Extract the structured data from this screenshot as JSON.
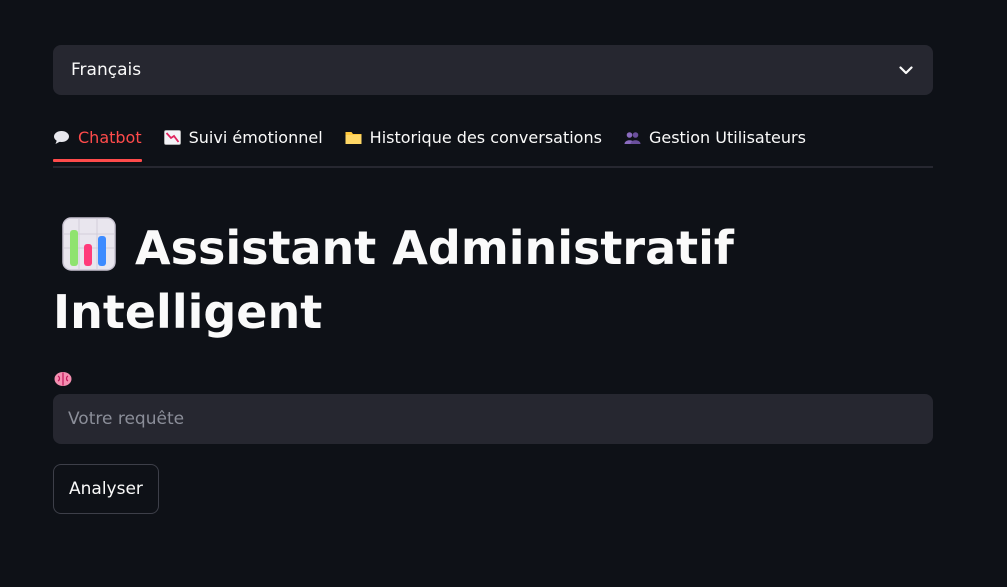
{
  "language_select": {
    "value": "Français",
    "icon": "chevron-down-icon"
  },
  "tabs": [
    {
      "label": "Chatbot",
      "icon": "speech-bubble-icon",
      "active": true
    },
    {
      "label": "Suivi émotionnel",
      "icon": "chart-decreasing-icon",
      "active": false
    },
    {
      "label": "Historique des conversations",
      "icon": "folder-icon",
      "active": false
    },
    {
      "label": "Gestion Utilisateurs",
      "icon": "users-icon",
      "active": false
    }
  ],
  "main": {
    "title": "Assistant Administratif Intelligent",
    "title_icon": "bar-chart-icon",
    "input_label_icon": "brain-icon",
    "query_placeholder": "Votre requête",
    "query_value": "",
    "analyze_label": "Analyser"
  },
  "colors": {
    "background": "#0e1117",
    "surface": "#262730",
    "accent": "#ff4b4b",
    "text": "#fafafa",
    "placeholder": "#8b8e99"
  }
}
